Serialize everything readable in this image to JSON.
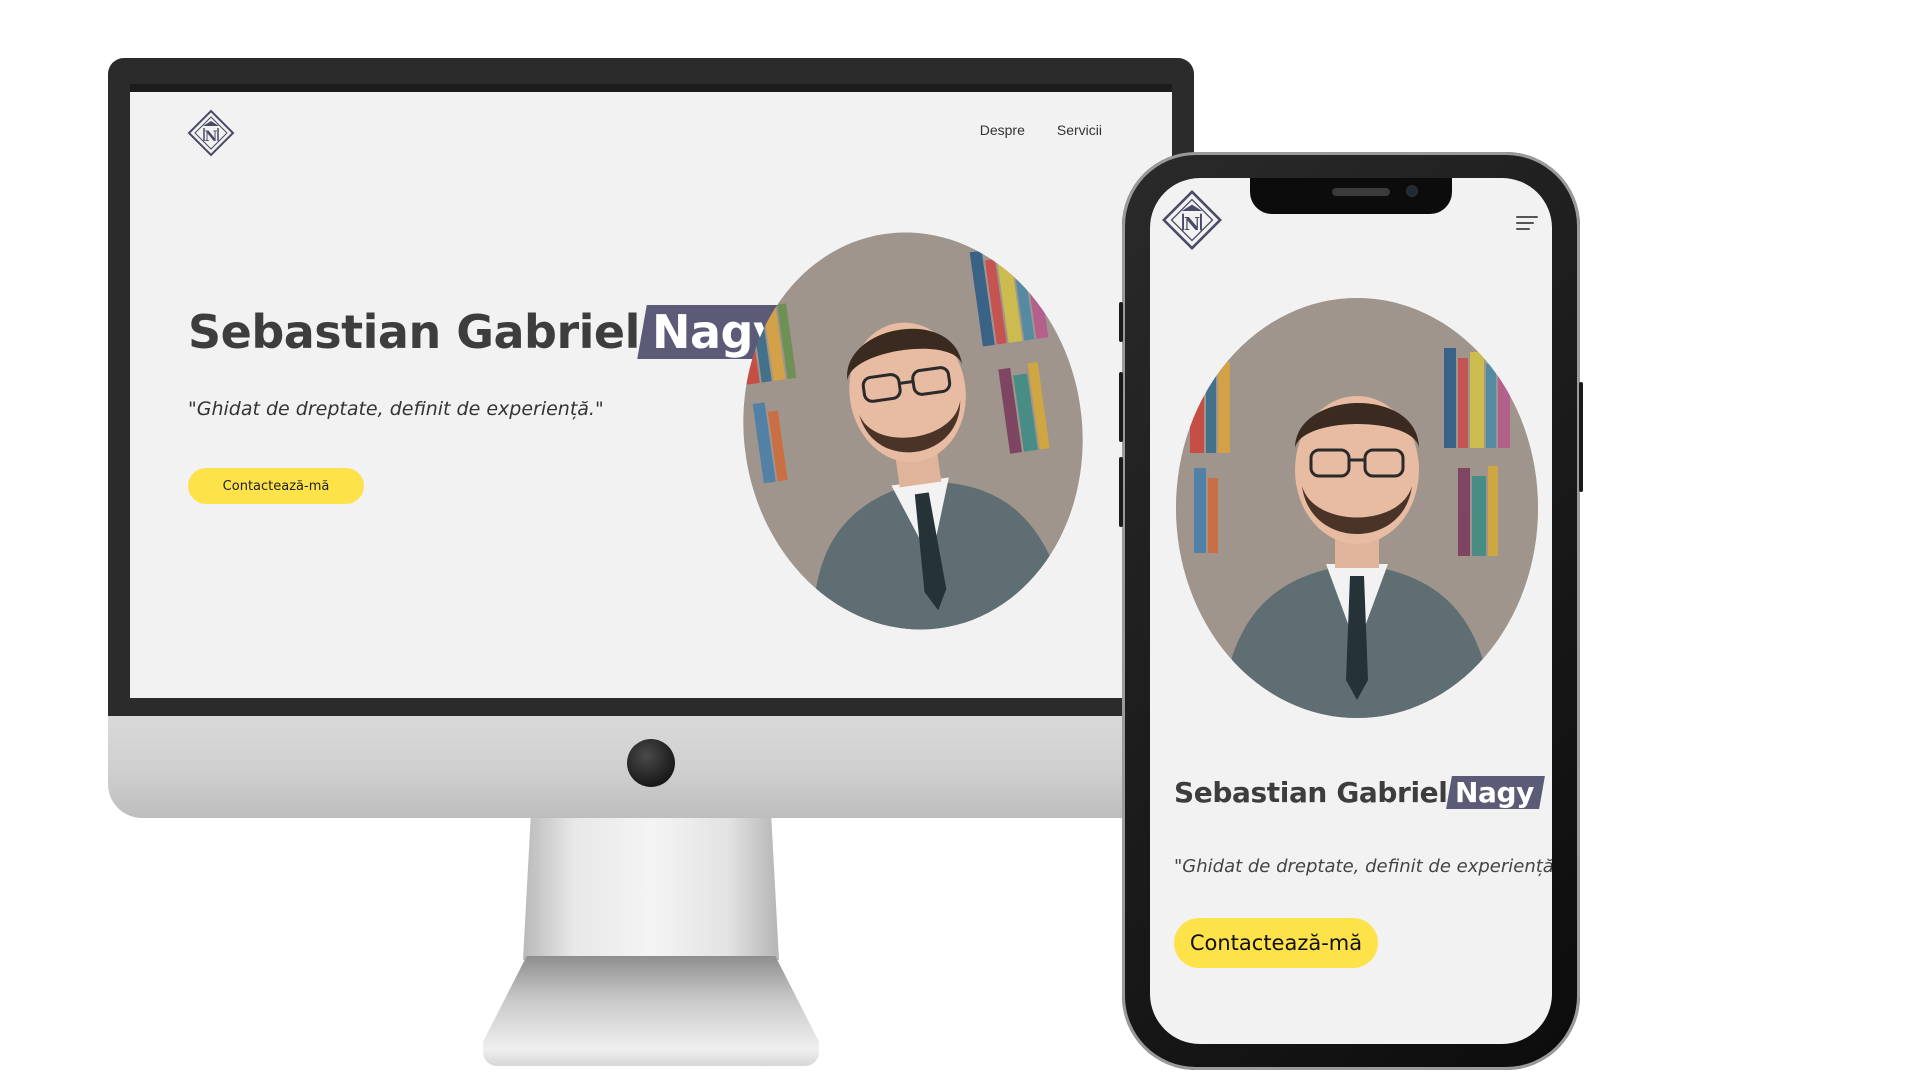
{
  "desktop": {
    "nav": {
      "about_label": "Despre",
      "services_label": "Servicii"
    },
    "hero": {
      "name_prefix": "Sebastian Gabriel",
      "name_highlight": "Nagy",
      "quote": "\"Ghidat de dreptate, definit de experiență.\"",
      "cta_label": "Contactează-mă"
    }
  },
  "mobile": {
    "hero": {
      "name_prefix": "Sebastian Gabriel",
      "name_highlight": "Nagy",
      "quote": "\"Ghidat de dreptate, definit de experiență.\"",
      "cta_label": "Contactează-mă"
    }
  },
  "icons": {
    "logo": "diamond-monogram-logo-icon",
    "menu": "hamburger-menu-icon"
  },
  "colors": {
    "background": "#f2f2f2",
    "accent_yellow": "#fde24a",
    "highlight_slate": "#5b5b78",
    "text_dark": "#3d3d3d"
  }
}
